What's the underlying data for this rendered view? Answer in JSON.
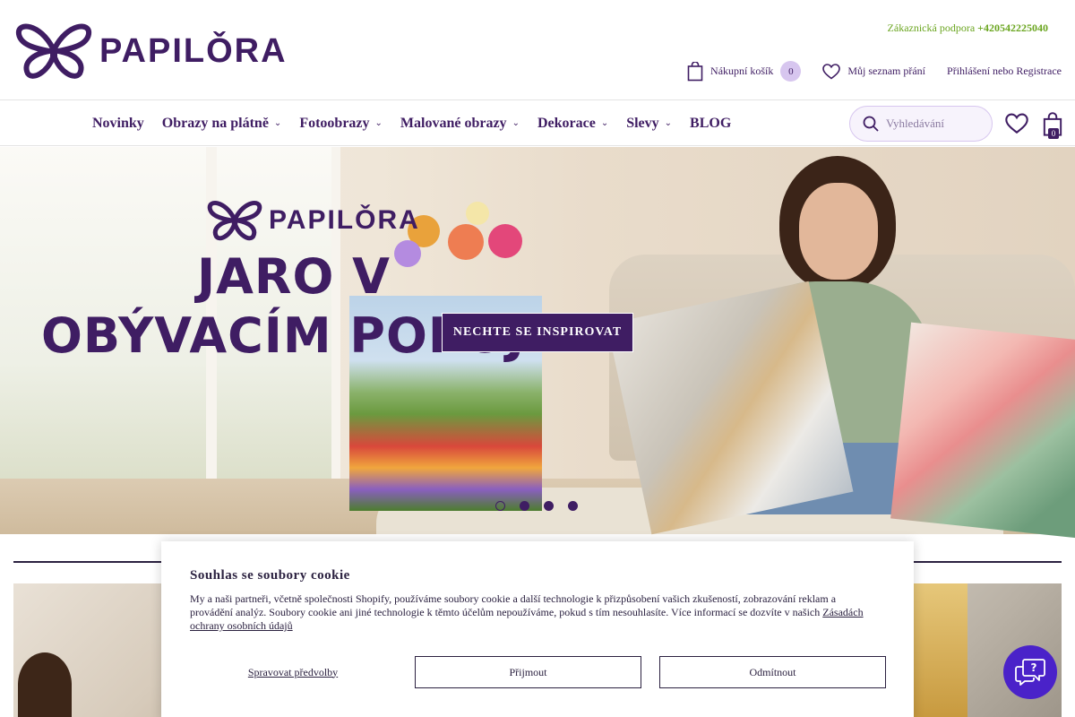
{
  "header": {
    "logo_text": "PAPILǑRA",
    "support_label": "Zákaznická podpora",
    "support_phone": "+420542225040",
    "cart_label": "Nákupní košík",
    "cart_count": "0",
    "wishlist_label": "Můj seznam přání",
    "login_label": "Přihlášení nebo Registrace"
  },
  "nav": {
    "items": [
      {
        "label": "Novinky",
        "has_dropdown": false
      },
      {
        "label": "Obrazy na plátně",
        "has_dropdown": true
      },
      {
        "label": "Fotoobrazy",
        "has_dropdown": true
      },
      {
        "label": "Malované obrazy",
        "has_dropdown": true
      },
      {
        "label": "Dekorace",
        "has_dropdown": true
      },
      {
        "label": "Slevy",
        "has_dropdown": true
      },
      {
        "label": "BLOG",
        "has_dropdown": false
      }
    ],
    "search_placeholder": "Vyhledávání",
    "bag_count": "0"
  },
  "hero": {
    "logo_text": "PAPILǑRA",
    "title_line1": "JARO V",
    "title_line2": "OBÝVACÍM POKOJI",
    "cta_label": "NECHTE SE INSPIROVAT",
    "slides": 4,
    "active_slide": 1
  },
  "cookie": {
    "title": "Souhlas se soubory cookie",
    "text": "My a naši partneři, včetně společnosti Shopify, používáme soubory cookie a další technologie k přizpůsobení vašich zkušeností, zobrazování reklam a provádění analýz. Soubory cookie ani jiné technologie k těmto účelům nepoužíváme, pokud s tím nesouhlasíte. Více informací se dozvíte v našich",
    "link_text": "Zásadách ochrany osobních údajů",
    "manage_label": "Spravovat předvolby",
    "accept_label": "Přijmout",
    "decline_label": "Odmítnout"
  },
  "colors": {
    "brand": "#3f1d63",
    "support_green": "#6aa51f",
    "chat": "#4a22c9"
  },
  "icons": {
    "cart": "shopping-bag-icon",
    "wishlist": "heart-icon",
    "search": "search-icon",
    "chat": "chat-help-icon"
  }
}
